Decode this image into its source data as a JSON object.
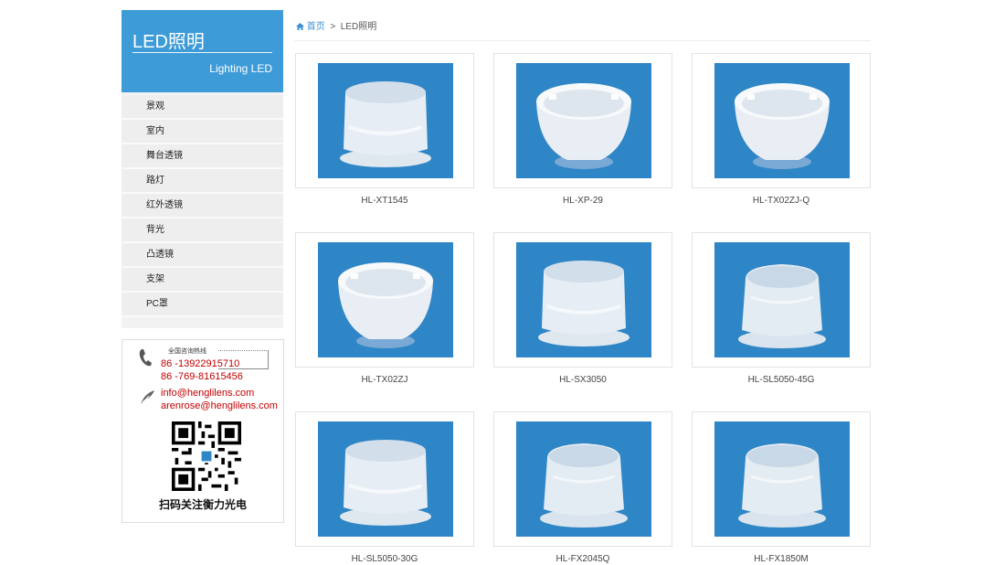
{
  "sidebar": {
    "title": "LED照明",
    "subtitle": "Lighting LED",
    "items": [
      "景观",
      "室内",
      "舞台透镜",
      "路灯",
      "红外透镜",
      "背光",
      "凸透镜",
      "支架",
      "PC罩"
    ]
  },
  "contact": {
    "hotline_label": "全国咨询热线",
    "phone1": "86 -13922915710",
    "phone2": "86 -769-81615456",
    "email1": "info@henglilens.com",
    "email2": "arenrose@henglilens.com",
    "qr_caption": "扫码关注衡力光电"
  },
  "breadcrumb": {
    "home": "首页",
    "separator": ">",
    "current": "LED照明"
  },
  "products": [
    {
      "name": "HL-XT1545"
    },
    {
      "name": "HL-XP-29"
    },
    {
      "name": "HL-TX02ZJ-Q"
    },
    {
      "name": "HL-TX02ZJ"
    },
    {
      "name": "HL-SX3050"
    },
    {
      "name": "HL-SL5050-45G"
    },
    {
      "name": "HL-SL5050-30G"
    },
    {
      "name": "HL-FX2045Q"
    },
    {
      "name": "HL-FX1850M"
    }
  ],
  "colors": {
    "accent": "#3d9bd7",
    "photo_bg": "#2f86c6",
    "contact_red": "#c00000"
  }
}
